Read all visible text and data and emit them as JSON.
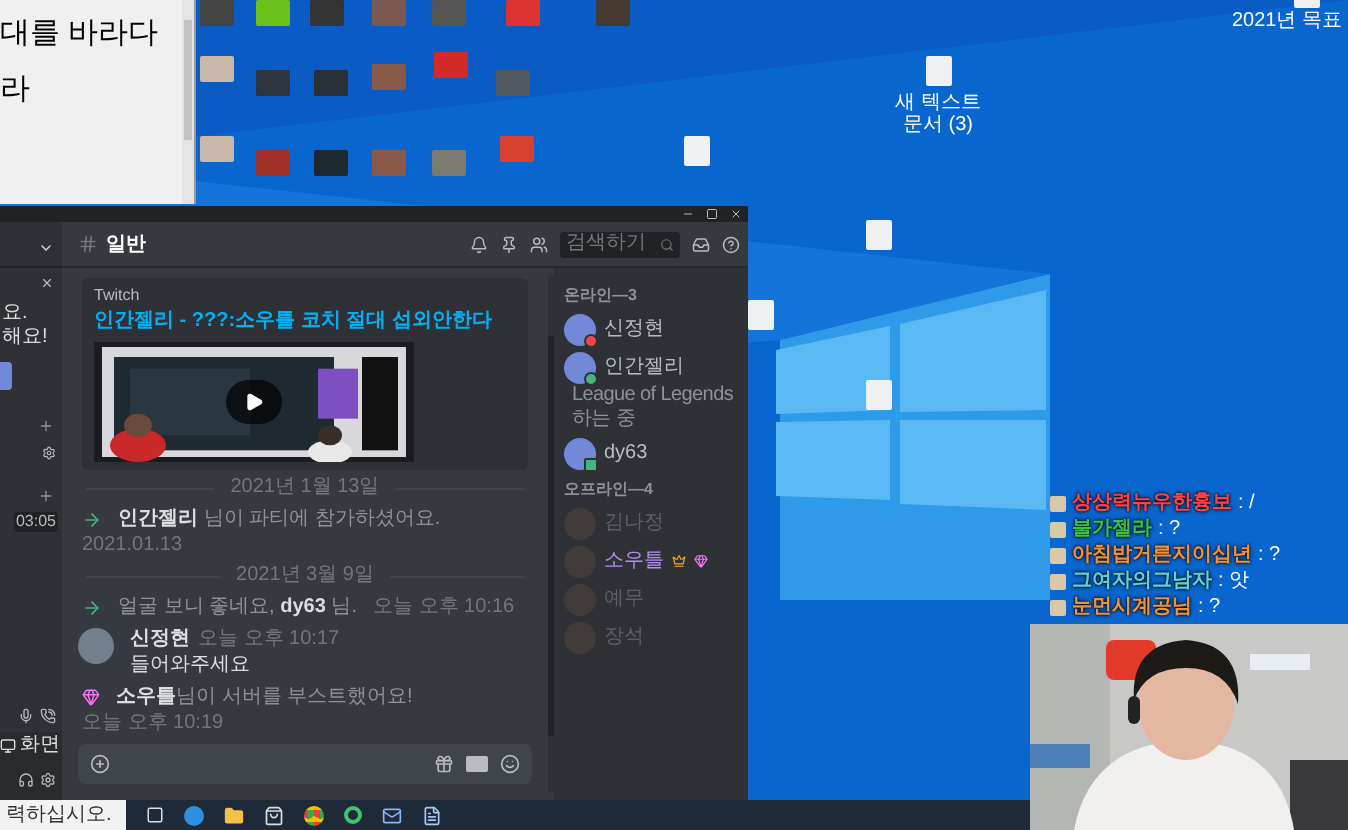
{
  "notepad": {
    "lines": [
      "대를 바라다",
      "라"
    ]
  },
  "desktop_icons": [
    {
      "label": "2021년 목표"
    },
    {
      "label": "새 텍스트 문서 (3)"
    }
  ],
  "discord": {
    "sidebar": {
      "notice": [
        "요.",
        "해요!"
      ],
      "timer": "03:05",
      "screen_label": "화면"
    },
    "channel": "일반",
    "search": {
      "placeholder": "검색하기"
    },
    "embed": {
      "provider": "Twitch",
      "title": "인간젤리 - ???:소우틀 코치 절대 섭외안한다"
    },
    "messages": [
      {
        "kind": "divider",
        "text": "2021년 1월 13일"
      },
      {
        "kind": "join",
        "text": "**인간젤리** 님이 파티에 참가하셨어요.",
        "time": "2021.01.13"
      },
      {
        "kind": "divider",
        "text": "2021년 3월 9일"
      },
      {
        "kind": "join",
        "text": "얼굴 보니 좋네요, **dy63** 님.",
        "time": "오늘 오후 10:16"
      },
      {
        "kind": "message",
        "author": "신정현",
        "time": "오늘 오후 10:17",
        "text": "들어와주세요"
      },
      {
        "kind": "boost",
        "text": "**소우틀**님이 서버를 부스트했어요!",
        "time": "오늘 오후 10:19"
      }
    ],
    "member_groups": [
      {
        "title": "온라인—3",
        "members": [
          {
            "name": "신정현",
            "kind": "dnd",
            "booster": false
          },
          {
            "name": "인간젤리",
            "kind": "online",
            "booster": false,
            "activity": "League of Legends 하는 중"
          },
          {
            "name": "dy63",
            "kind": "mobile",
            "booster": false
          }
        ]
      },
      {
        "title": "오프라인—4",
        "members": [
          {
            "name": "김나정",
            "kind": "offline",
            "booster": false
          },
          {
            "name": "소우틀",
            "kind": "offline",
            "booster": true
          },
          {
            "name": "예무",
            "kind": "offline",
            "booster": false
          },
          {
            "name": "장석",
            "kind": "offline",
            "booster": false
          }
        ]
      }
    ]
  },
  "taskbar": {
    "search_placeholder": "력하십시오."
  },
  "chat_overlay": [
    {
      "name": "상상력뉴우한흉보",
      "text": ": /",
      "color": "#ff4048"
    },
    {
      "name": "불가젤라",
      "text": ": ?",
      "color": "#3fbf4a"
    },
    {
      "name": "아침밥거른지이십년",
      "text": ": ?",
      "color": "#f0903a"
    },
    {
      "name": "그여자의그남자",
      "text": ": 앗",
      "color": "#5fd0d8"
    },
    {
      "name": "눈먼시계공님",
      "text": ": ?",
      "color": "#f0903a"
    }
  ]
}
